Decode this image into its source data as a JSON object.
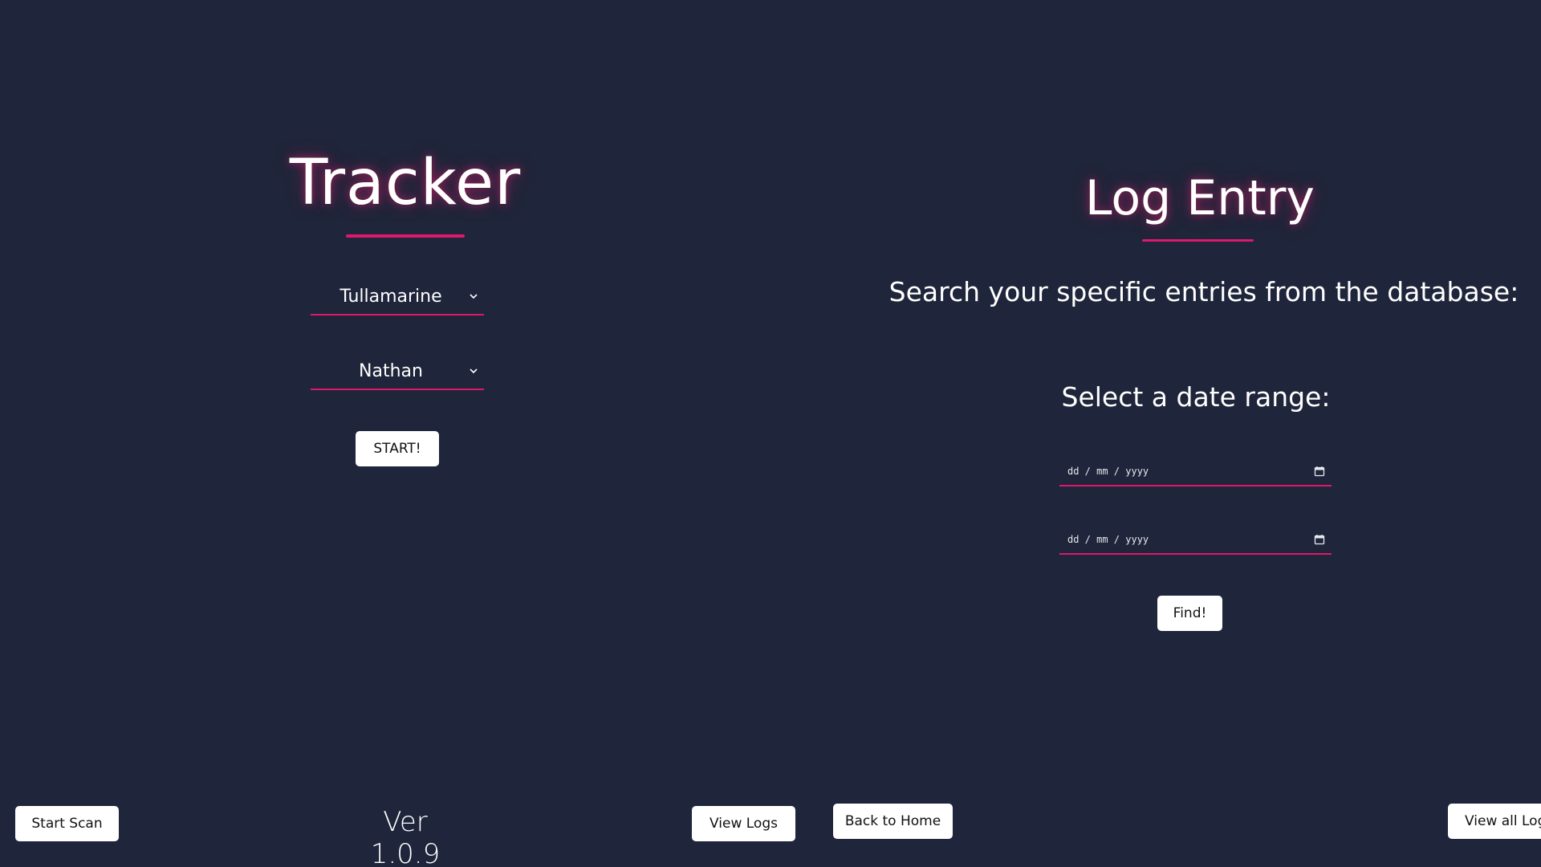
{
  "tracker": {
    "title": "Tracker",
    "location_select": {
      "value": "Tullamarine"
    },
    "person_select": {
      "value": "Nathan"
    },
    "start_button": "START!",
    "start_scan_button": "Start Scan",
    "version": "Ver 1.0.9",
    "view_logs_button": "View Logs"
  },
  "log_entry": {
    "title": "Log Entry",
    "subtitle": "Search your specific entries from the database:",
    "range_label": "Select a date range:",
    "start_date": {
      "placeholder": "dd / mm / yyyy"
    },
    "end_date": {
      "placeholder": "dd / mm / yyyy"
    },
    "find_button": "Find!",
    "back_home_button": "Back to Home",
    "view_all_logs_button": "View all Logs"
  },
  "icons": {
    "select_chevron": "chevron-down-icon",
    "date_picker": "calendar-icon"
  },
  "colors": {
    "background": "#1f253a",
    "accent": "#e0186c",
    "button_bg": "#ffffff",
    "text": "#ffffff"
  }
}
